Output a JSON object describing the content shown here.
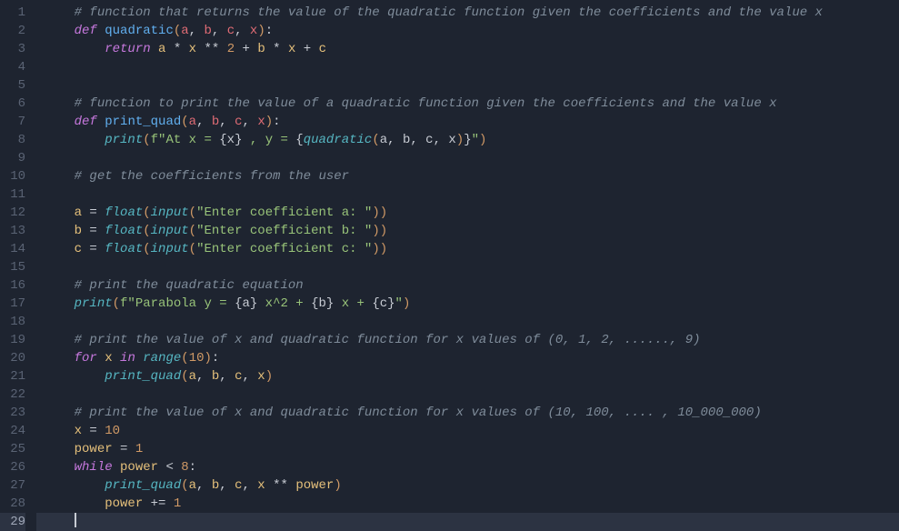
{
  "editor": {
    "language": "python",
    "current_line": 29,
    "line_count": 29,
    "lines": [
      {
        "n": 1,
        "tokens": [
          {
            "t": "    ",
            "c": ""
          },
          {
            "t": "# function that returns the value of the quadratic function given the coefficients and the value x",
            "c": "c-comment"
          }
        ]
      },
      {
        "n": 2,
        "tokens": [
          {
            "t": "    ",
            "c": ""
          },
          {
            "t": "def",
            "c": "c-keyword"
          },
          {
            "t": " ",
            "c": ""
          },
          {
            "t": "quadratic",
            "c": "c-funcdef"
          },
          {
            "t": "(",
            "c": "c-paren"
          },
          {
            "t": "a",
            "c": "c-param"
          },
          {
            "t": ", ",
            "c": "c-op"
          },
          {
            "t": "b",
            "c": "c-param"
          },
          {
            "t": ", ",
            "c": "c-op"
          },
          {
            "t": "c",
            "c": "c-param"
          },
          {
            "t": ", ",
            "c": "c-op"
          },
          {
            "t": "x",
            "c": "c-param"
          },
          {
            "t": ")",
            "c": "c-paren"
          },
          {
            "t": ":",
            "c": "c-op"
          }
        ]
      },
      {
        "n": 3,
        "tokens": [
          {
            "t": "        ",
            "c": ""
          },
          {
            "t": "return",
            "c": "c-keyword"
          },
          {
            "t": " ",
            "c": ""
          },
          {
            "t": "a",
            "c": "c-var"
          },
          {
            "t": " * ",
            "c": "c-op"
          },
          {
            "t": "x",
            "c": "c-var"
          },
          {
            "t": " ** ",
            "c": "c-op"
          },
          {
            "t": "2",
            "c": "c-num"
          },
          {
            "t": " + ",
            "c": "c-op"
          },
          {
            "t": "b",
            "c": "c-var"
          },
          {
            "t": " * ",
            "c": "c-op"
          },
          {
            "t": "x",
            "c": "c-var"
          },
          {
            "t": " + ",
            "c": "c-op"
          },
          {
            "t": "c",
            "c": "c-var"
          }
        ]
      },
      {
        "n": 4,
        "tokens": []
      },
      {
        "n": 5,
        "tokens": []
      },
      {
        "n": 6,
        "tokens": [
          {
            "t": "    ",
            "c": ""
          },
          {
            "t": "# function to print the value of a quadratic function given the coefficients and the value x",
            "c": "c-comment"
          }
        ]
      },
      {
        "n": 7,
        "tokens": [
          {
            "t": "    ",
            "c": ""
          },
          {
            "t": "def",
            "c": "c-keyword"
          },
          {
            "t": " ",
            "c": ""
          },
          {
            "t": "print_quad",
            "c": "c-funcdef"
          },
          {
            "t": "(",
            "c": "c-paren"
          },
          {
            "t": "a",
            "c": "c-param"
          },
          {
            "t": ", ",
            "c": "c-op"
          },
          {
            "t": "b",
            "c": "c-param"
          },
          {
            "t": ", ",
            "c": "c-op"
          },
          {
            "t": "c",
            "c": "c-param"
          },
          {
            "t": ", ",
            "c": "c-op"
          },
          {
            "t": "x",
            "c": "c-param"
          },
          {
            "t": ")",
            "c": "c-paren"
          },
          {
            "t": ":",
            "c": "c-op"
          }
        ]
      },
      {
        "n": 8,
        "tokens": [
          {
            "t": "        ",
            "c": ""
          },
          {
            "t": "print",
            "c": "c-builtin"
          },
          {
            "t": "(",
            "c": "c-paren"
          },
          {
            "t": "f\"At x = ",
            "c": "c-fstr"
          },
          {
            "t": "{",
            "c": "c-op"
          },
          {
            "t": "x",
            "c": "c-fexpr"
          },
          {
            "t": "}",
            "c": "c-op"
          },
          {
            "t": " , y = ",
            "c": "c-fstr"
          },
          {
            "t": "{",
            "c": "c-op"
          },
          {
            "t": "quadratic",
            "c": "c-funccall"
          },
          {
            "t": "(",
            "c": "c-paren"
          },
          {
            "t": "a",
            "c": "c-fexpr"
          },
          {
            "t": ", ",
            "c": "c-op"
          },
          {
            "t": "b",
            "c": "c-fexpr"
          },
          {
            "t": ", ",
            "c": "c-op"
          },
          {
            "t": "c",
            "c": "c-fexpr"
          },
          {
            "t": ", ",
            "c": "c-op"
          },
          {
            "t": "x",
            "c": "c-fexpr"
          },
          {
            "t": ")",
            "c": "c-paren"
          },
          {
            "t": "}",
            "c": "c-op"
          },
          {
            "t": "\"",
            "c": "c-fstr"
          },
          {
            "t": ")",
            "c": "c-paren"
          }
        ]
      },
      {
        "n": 9,
        "tokens": []
      },
      {
        "n": 10,
        "tokens": [
          {
            "t": "    ",
            "c": ""
          },
          {
            "t": "# get the coefficients from the user",
            "c": "c-comment"
          }
        ]
      },
      {
        "n": 11,
        "tokens": []
      },
      {
        "n": 12,
        "tokens": [
          {
            "t": "    ",
            "c": ""
          },
          {
            "t": "a",
            "c": "c-var"
          },
          {
            "t": " = ",
            "c": "c-op"
          },
          {
            "t": "float",
            "c": "c-builtin"
          },
          {
            "t": "(",
            "c": "c-paren"
          },
          {
            "t": "input",
            "c": "c-builtin"
          },
          {
            "t": "(",
            "c": "c-paren"
          },
          {
            "t": "\"Enter coefficient a: \"",
            "c": "c-string"
          },
          {
            "t": "))",
            "c": "c-paren"
          }
        ]
      },
      {
        "n": 13,
        "tokens": [
          {
            "t": "    ",
            "c": ""
          },
          {
            "t": "b",
            "c": "c-var"
          },
          {
            "t": " = ",
            "c": "c-op"
          },
          {
            "t": "float",
            "c": "c-builtin"
          },
          {
            "t": "(",
            "c": "c-paren"
          },
          {
            "t": "input",
            "c": "c-builtin"
          },
          {
            "t": "(",
            "c": "c-paren"
          },
          {
            "t": "\"Enter coefficient b: \"",
            "c": "c-string"
          },
          {
            "t": "))",
            "c": "c-paren"
          }
        ]
      },
      {
        "n": 14,
        "tokens": [
          {
            "t": "    ",
            "c": ""
          },
          {
            "t": "c",
            "c": "c-var"
          },
          {
            "t": " = ",
            "c": "c-op"
          },
          {
            "t": "float",
            "c": "c-builtin"
          },
          {
            "t": "(",
            "c": "c-paren"
          },
          {
            "t": "input",
            "c": "c-builtin"
          },
          {
            "t": "(",
            "c": "c-paren"
          },
          {
            "t": "\"Enter coefficient c: \"",
            "c": "c-string"
          },
          {
            "t": "))",
            "c": "c-paren"
          }
        ]
      },
      {
        "n": 15,
        "tokens": []
      },
      {
        "n": 16,
        "tokens": [
          {
            "t": "    ",
            "c": ""
          },
          {
            "t": "# print the quadratic equation",
            "c": "c-comment"
          }
        ]
      },
      {
        "n": 17,
        "tokens": [
          {
            "t": "    ",
            "c": ""
          },
          {
            "t": "print",
            "c": "c-builtin"
          },
          {
            "t": "(",
            "c": "c-paren"
          },
          {
            "t": "f\"Parabola y = ",
            "c": "c-fstr"
          },
          {
            "t": "{",
            "c": "c-op"
          },
          {
            "t": "a",
            "c": "c-fexpr"
          },
          {
            "t": "}",
            "c": "c-op"
          },
          {
            "t": " x^2 + ",
            "c": "c-fstr"
          },
          {
            "t": "{",
            "c": "c-op"
          },
          {
            "t": "b",
            "c": "c-fexpr"
          },
          {
            "t": "}",
            "c": "c-op"
          },
          {
            "t": " x + ",
            "c": "c-fstr"
          },
          {
            "t": "{",
            "c": "c-op"
          },
          {
            "t": "c",
            "c": "c-fexpr"
          },
          {
            "t": "}",
            "c": "c-op"
          },
          {
            "t": "\"",
            "c": "c-fstr"
          },
          {
            "t": ")",
            "c": "c-paren"
          }
        ]
      },
      {
        "n": 18,
        "tokens": []
      },
      {
        "n": 19,
        "tokens": [
          {
            "t": "    ",
            "c": ""
          },
          {
            "t": "# print the value of x and quadratic function for x values of (0, 1, 2, ......, 9)",
            "c": "c-comment"
          }
        ]
      },
      {
        "n": 20,
        "tokens": [
          {
            "t": "    ",
            "c": ""
          },
          {
            "t": "for",
            "c": "c-keyword"
          },
          {
            "t": " ",
            "c": ""
          },
          {
            "t": "x",
            "c": "c-var"
          },
          {
            "t": " ",
            "c": ""
          },
          {
            "t": "in",
            "c": "c-keyword"
          },
          {
            "t": " ",
            "c": ""
          },
          {
            "t": "range",
            "c": "c-builtin"
          },
          {
            "t": "(",
            "c": "c-paren"
          },
          {
            "t": "10",
            "c": "c-num"
          },
          {
            "t": ")",
            "c": "c-paren"
          },
          {
            "t": ":",
            "c": "c-op"
          }
        ]
      },
      {
        "n": 21,
        "tokens": [
          {
            "t": "        ",
            "c": ""
          },
          {
            "t": "print_quad",
            "c": "c-funccall"
          },
          {
            "t": "(",
            "c": "c-paren"
          },
          {
            "t": "a",
            "c": "c-var"
          },
          {
            "t": ", ",
            "c": "c-op"
          },
          {
            "t": "b",
            "c": "c-var"
          },
          {
            "t": ", ",
            "c": "c-op"
          },
          {
            "t": "c",
            "c": "c-var"
          },
          {
            "t": ", ",
            "c": "c-op"
          },
          {
            "t": "x",
            "c": "c-var"
          },
          {
            "t": ")",
            "c": "c-paren"
          }
        ]
      },
      {
        "n": 22,
        "tokens": []
      },
      {
        "n": 23,
        "tokens": [
          {
            "t": "    ",
            "c": ""
          },
          {
            "t": "# print the value of x and quadratic function for x values of (10, 100, .... , 10_000_000)",
            "c": "c-comment"
          }
        ]
      },
      {
        "n": 24,
        "tokens": [
          {
            "t": "    ",
            "c": ""
          },
          {
            "t": "x",
            "c": "c-var"
          },
          {
            "t": " = ",
            "c": "c-op"
          },
          {
            "t": "10",
            "c": "c-num"
          }
        ]
      },
      {
        "n": 25,
        "tokens": [
          {
            "t": "    ",
            "c": ""
          },
          {
            "t": "power",
            "c": "c-var"
          },
          {
            "t": " = ",
            "c": "c-op"
          },
          {
            "t": "1",
            "c": "c-num"
          }
        ]
      },
      {
        "n": 26,
        "tokens": [
          {
            "t": "    ",
            "c": ""
          },
          {
            "t": "while",
            "c": "c-keyword"
          },
          {
            "t": " ",
            "c": ""
          },
          {
            "t": "power",
            "c": "c-var"
          },
          {
            "t": " < ",
            "c": "c-op"
          },
          {
            "t": "8",
            "c": "c-num"
          },
          {
            "t": ":",
            "c": "c-op"
          }
        ]
      },
      {
        "n": 27,
        "tokens": [
          {
            "t": "        ",
            "c": ""
          },
          {
            "t": "print_quad",
            "c": "c-funccall"
          },
          {
            "t": "(",
            "c": "c-paren"
          },
          {
            "t": "a",
            "c": "c-var"
          },
          {
            "t": ", ",
            "c": "c-op"
          },
          {
            "t": "b",
            "c": "c-var"
          },
          {
            "t": ", ",
            "c": "c-op"
          },
          {
            "t": "c",
            "c": "c-var"
          },
          {
            "t": ", ",
            "c": "c-op"
          },
          {
            "t": "x",
            "c": "c-var"
          },
          {
            "t": " ** ",
            "c": "c-op"
          },
          {
            "t": "power",
            "c": "c-var"
          },
          {
            "t": ")",
            "c": "c-paren"
          }
        ]
      },
      {
        "n": 28,
        "tokens": [
          {
            "t": "        ",
            "c": ""
          },
          {
            "t": "power",
            "c": "c-var"
          },
          {
            "t": " += ",
            "c": "c-op"
          },
          {
            "t": "1",
            "c": "c-num"
          }
        ]
      },
      {
        "n": 29,
        "tokens": [
          {
            "t": "    ",
            "c": ""
          }
        ]
      }
    ]
  }
}
